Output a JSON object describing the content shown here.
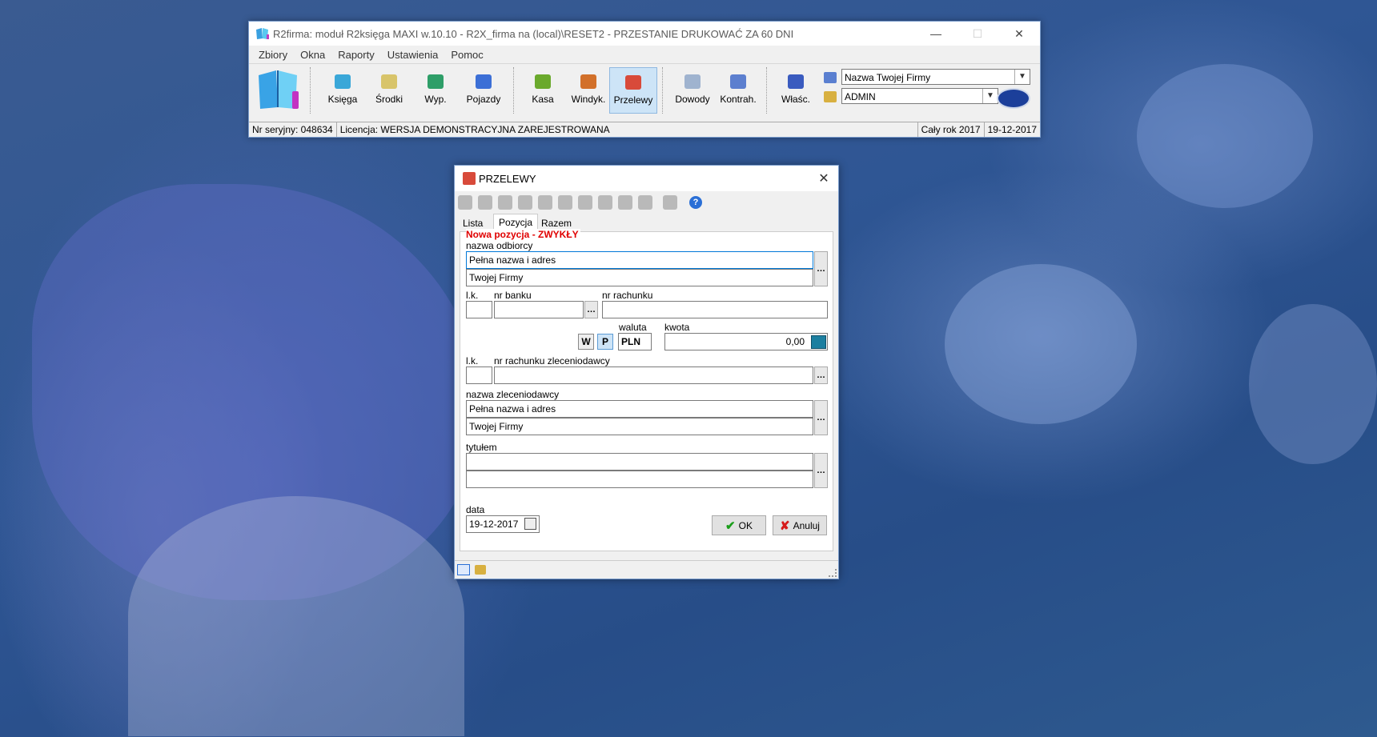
{
  "main_window": {
    "title": "R2firma: moduł R2księga MAXI w.10.10 - R2X_firma na (local)\\RESET2 - PRZESTANIE DRUKOWAĆ ZA 60 DNI",
    "menu": [
      "Zbiory",
      "Okna",
      "Raporty",
      "Ustawienia",
      "Pomoc"
    ],
    "toolbar": [
      {
        "label": "Księga"
      },
      {
        "label": "Środki"
      },
      {
        "label": "Wyp."
      },
      {
        "label": "Pojazdy"
      },
      {
        "label": "Kasa"
      },
      {
        "label": "Windyk."
      },
      {
        "label": "Przelewy"
      },
      {
        "label": "Dowody"
      },
      {
        "label": "Kontrah."
      },
      {
        "label": "Właśc."
      }
    ],
    "company_combo": "Nazwa Twojej Firmy",
    "user_combo": "ADMIN",
    "status": {
      "serial": "Nr seryjny: 048634",
      "license": "Licencja: WERSJA DEMONSTRACYJNA ZAREJESTROWANA",
      "period": "Cały rok 2017",
      "date": "19-12-2017"
    }
  },
  "dialog": {
    "title": "PRZELEWY",
    "tabs": [
      "Lista",
      "Pozycja",
      "Razem"
    ],
    "heading": "Nowa pozycja - ZWYKŁY",
    "labels": {
      "recipient_name": "nazwa odbiorcy",
      "lk": "l.k.",
      "bank_no": "nr banku",
      "account_no": "nr rachunku",
      "currency": "waluta",
      "amount": "kwota",
      "orderer_account": "nr rachunku zleceniodawcy",
      "orderer_name": "nazwa zleceniodawcy",
      "title": "tytułem",
      "date": "data"
    },
    "fields": {
      "recipient_line1": "Pełna nazwa i adres",
      "recipient_line2": "Twojej Firmy",
      "lk1": "",
      "bank_no": "",
      "account_no": "",
      "btn_w": "W",
      "btn_p": "P",
      "currency": "PLN",
      "amount": "0,00",
      "lk2": "",
      "orderer_account": "",
      "orderer_line1": "Pełna nazwa i adres",
      "orderer_line2": "Twojej Firmy",
      "title_line1": "",
      "title_line2": "",
      "date": "19-12-2017"
    },
    "buttons": {
      "ok": "OK",
      "cancel": "Anuluj"
    }
  },
  "colors": {
    "heading": "#e00000",
    "active_tab_bg": "#ffffff",
    "accent": "#0078d7"
  }
}
